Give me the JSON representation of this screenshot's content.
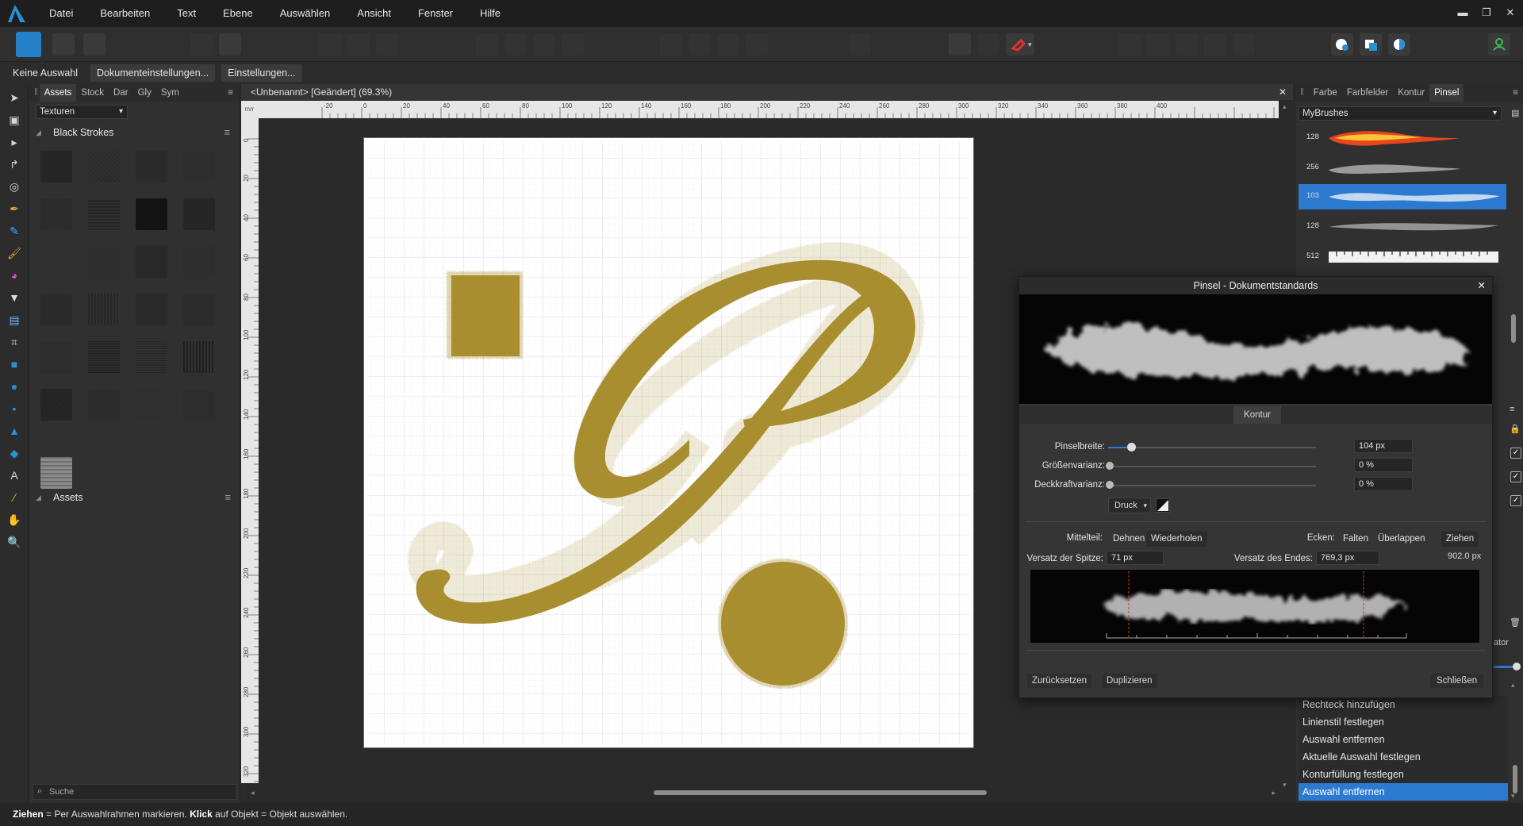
{
  "menubar": {
    "items": [
      "Datei",
      "Bearbeiten",
      "Text",
      "Ebene",
      "Auswählen",
      "Ansicht",
      "Fenster",
      "Hilfe"
    ],
    "window_controls": [
      "▬",
      "❐",
      "✕"
    ]
  },
  "context_bar": {
    "selection": "Keine Auswahl",
    "doc_settings": "Dokumenteinstellungen...",
    "settings": "Einstellungen..."
  },
  "assets_panel": {
    "tabs": [
      "Assets",
      "Stock",
      "Dar",
      "Gly",
      "Sym"
    ],
    "active_tab": "Assets",
    "category_select": "Texturen",
    "section_black_strokes": "Black Strokes",
    "section_assets": "Assets",
    "search_placeholder": "Suche"
  },
  "document": {
    "tab_title": "<Unbenannt> [Geändert] (69.3%)",
    "ruler_unit": "mm",
    "ruler_top_labels": [
      "-20",
      "0",
      "20",
      "40",
      "60",
      "80",
      "100",
      "120",
      "140",
      "160",
      "180",
      "200",
      "220",
      "240",
      "260",
      "280",
      "300",
      "320",
      "340",
      "360",
      "380",
      "400"
    ],
    "ruler_left_labels": [
      "0",
      "20",
      "40",
      "60",
      "80",
      "100",
      "120",
      "140",
      "160",
      "180",
      "200",
      "220",
      "240",
      "260",
      "280",
      "300",
      "320"
    ],
    "art_color": "#a88e2e"
  },
  "right_panel": {
    "tabs": [
      "Farbe",
      "Farbfelder",
      "Kontur",
      "Pinsel"
    ],
    "active_tab": "Pinsel",
    "brush_category": "MyBrushes",
    "brushes": [
      {
        "size": "128",
        "style": "fire"
      },
      {
        "size": "256",
        "style": "smoke"
      },
      {
        "size": "103",
        "style": "cloud",
        "selected": true
      },
      {
        "size": "128",
        "style": "soft"
      },
      {
        "size": "512",
        "style": "ruler"
      }
    ],
    "history_items": [
      "Rechteck hinzufügen",
      "Linienstil festlegen",
      "Auswahl entfernen",
      "Aktuelle Auswahl festlegen",
      "Konturfüllung festlegen",
      "Auswahl entfernen"
    ],
    "history_selected_index": 5,
    "partial_label": "ator"
  },
  "brush_dialog": {
    "title": "Pinsel - Dokumentstandards",
    "section_tab": "Kontur",
    "brush_width_label": "Pinselbreite:",
    "brush_width_value": "104 px",
    "brush_width_fraction": 0.11,
    "size_variance_label": "Größenvarianz:",
    "size_variance_value": "0 %",
    "opacity_variance_label": "Deckkraftvarianz:",
    "opacity_variance_value": "0 %",
    "pressure_label": "Druck",
    "middle_label": "Mittelteil:",
    "middle_options": [
      "Dehnen",
      "Wiederholen"
    ],
    "middle_selected": "Wiederholen",
    "corners_label": "Ecken:",
    "corner_options": [
      "Falten",
      "Überlappen",
      "Ziehen"
    ],
    "corner_selected": "Ziehen",
    "tip_offset_label": "Versatz der Spitze:",
    "tip_offset_value": "71 px",
    "end_offset_label": "Versatz des Endes:",
    "end_offset_value": "769,3 px",
    "total_length": "902.0 px",
    "reset_button": "Zurücksetzen",
    "duplicate_button": "Duplizieren",
    "close_button": "Schließen"
  },
  "statusbar": {
    "drag_bold": "Ziehen",
    "drag_text": " = Per Auswahlrahmen markieren. ",
    "click_bold": "Klick",
    "click_text": " auf Objekt = Objekt auswählen."
  }
}
